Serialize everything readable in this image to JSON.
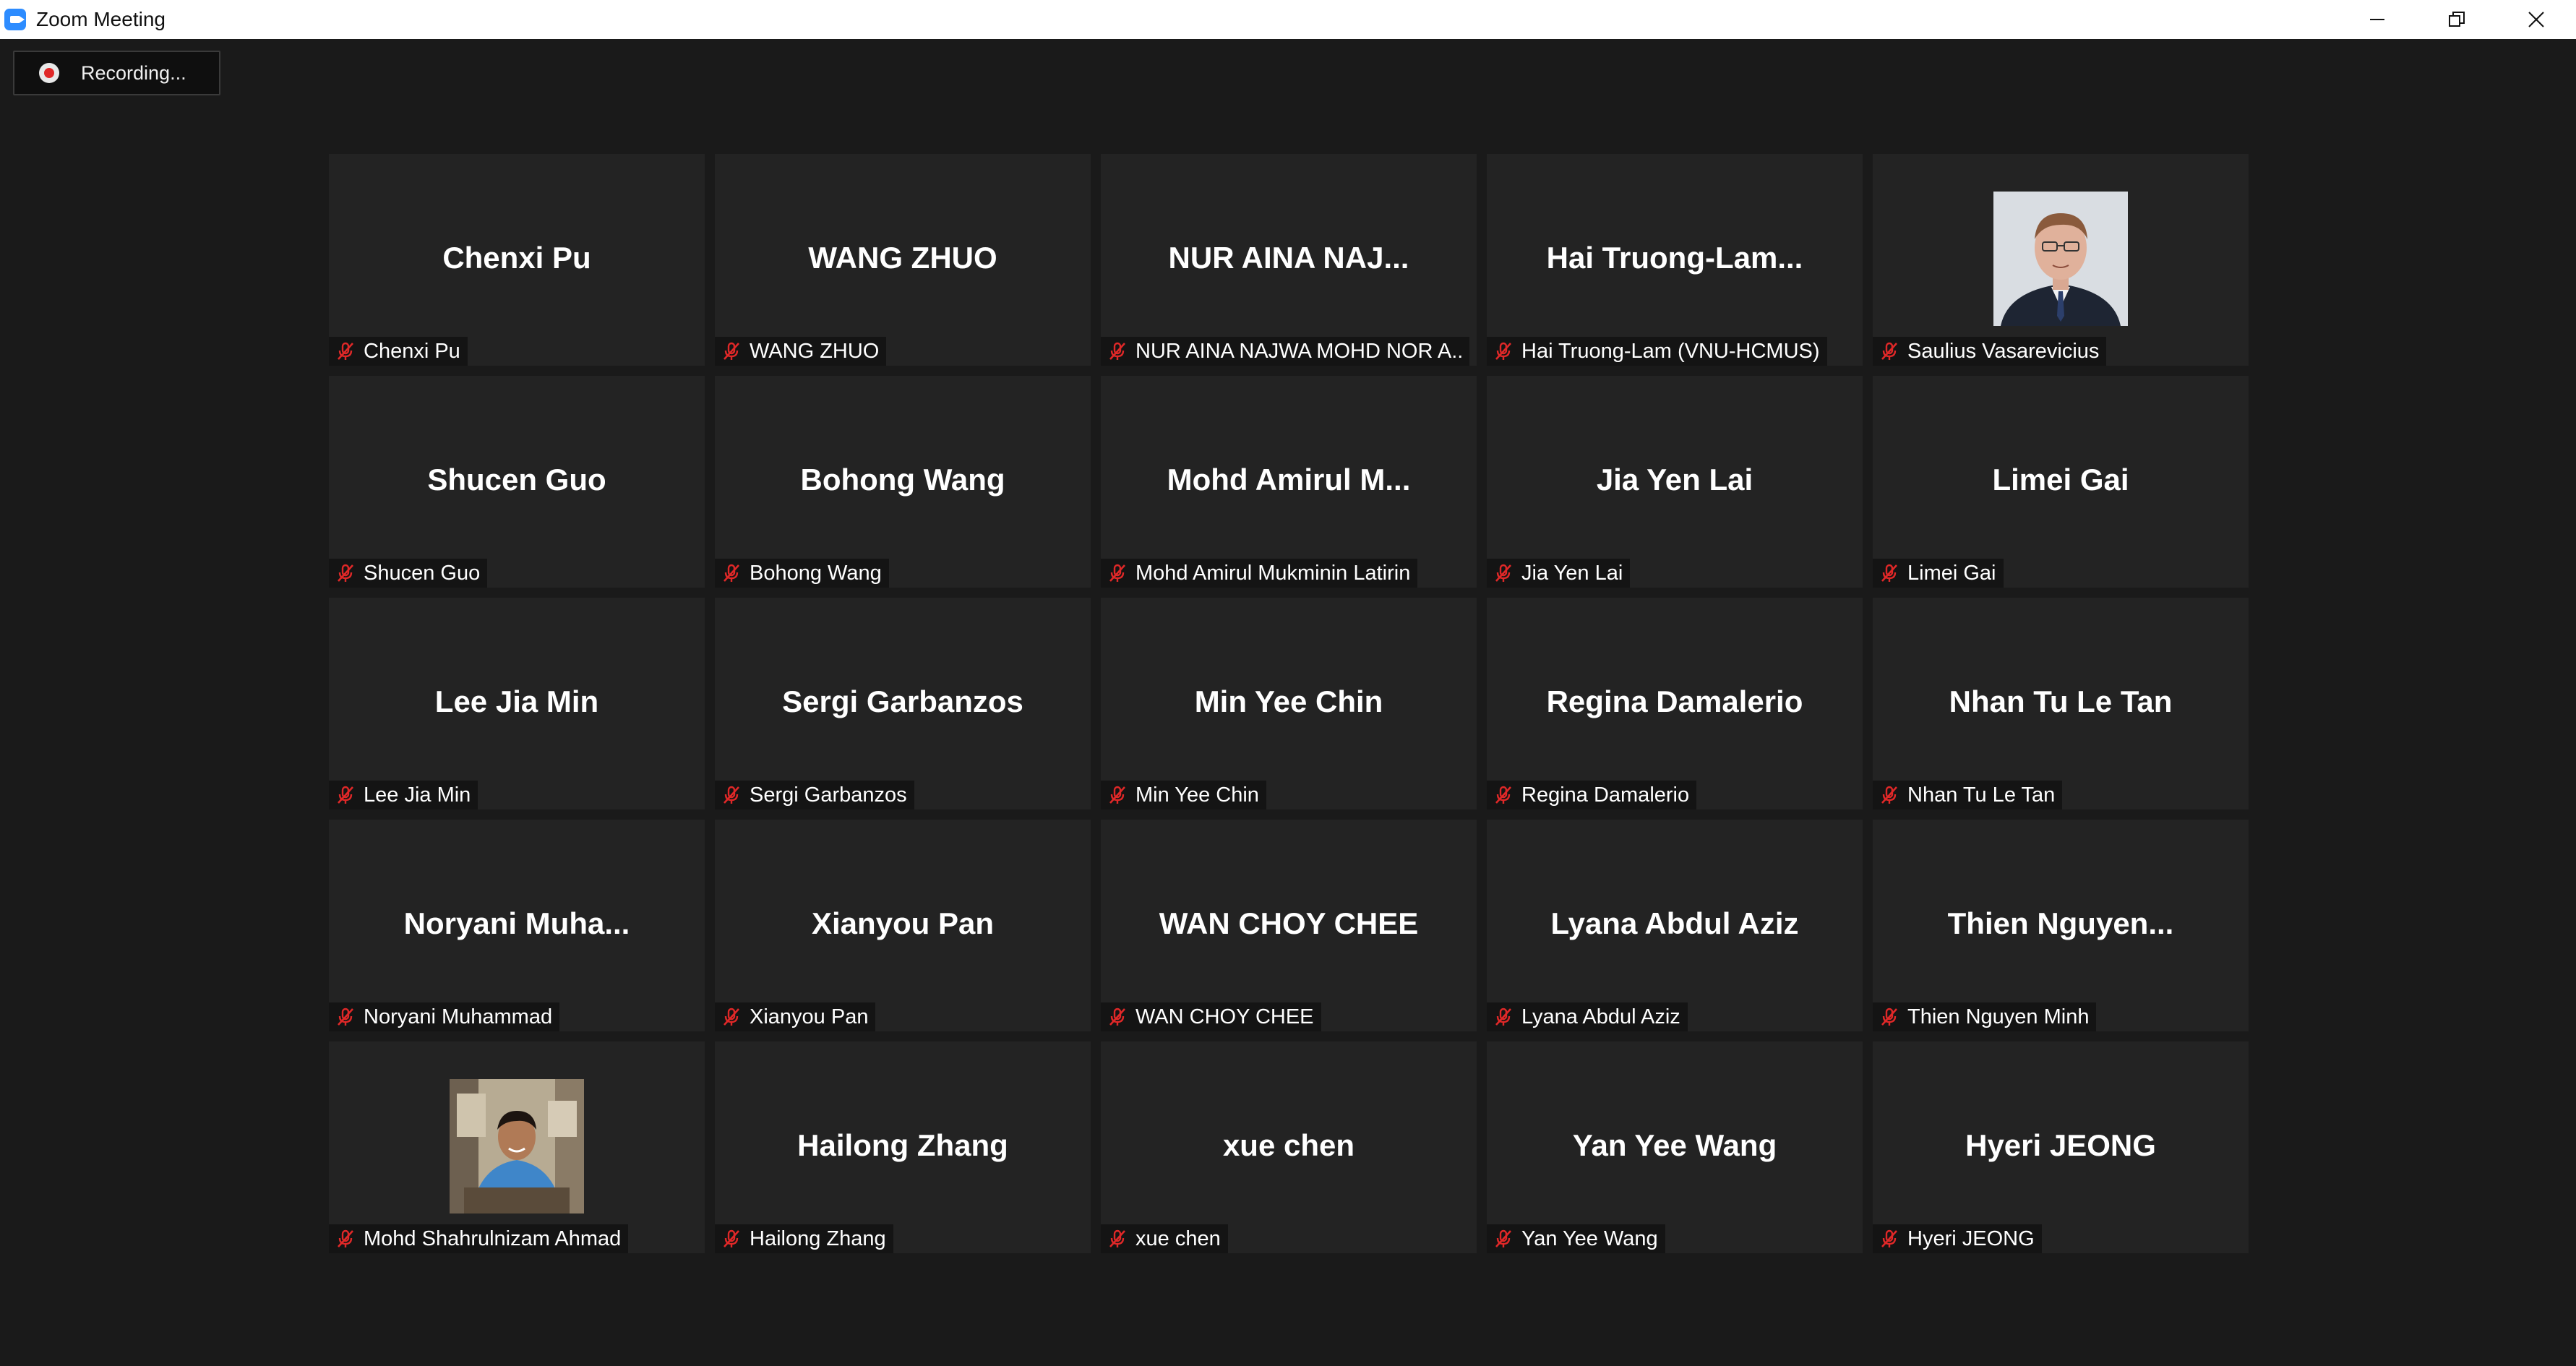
{
  "window": {
    "title": "Zoom Meeting",
    "icon": "zoom-camera-icon",
    "controls": [
      "minimize-icon",
      "restore-icon",
      "close-icon"
    ]
  },
  "recording": {
    "label": "Recording...",
    "icon": "record-dot-icon"
  },
  "colors": {
    "background": "#1a1a1a",
    "tile": "#232323",
    "mute": "#e02828",
    "titlebar": "#ffffff"
  },
  "participants": [
    {
      "display_name": "Chenxi Pu",
      "full_name": "Chenxi Pu",
      "muted": true
    },
    {
      "display_name": "WANG ZHUO",
      "full_name": "WANG ZHUO",
      "muted": true
    },
    {
      "display_name": "NUR AINA NAJ...",
      "full_name": "NUR AINA NAJWA MOHD NOR A...",
      "muted": true
    },
    {
      "display_name": "Hai Truong-Lam...",
      "full_name": "Hai Truong-Lam (VNU-HCMUS)",
      "muted": true
    },
    {
      "display_name": "",
      "full_name": "Saulius Vasarevicius",
      "muted": true,
      "photo": "profile-photo"
    },
    {
      "display_name": "Shucen Guo",
      "full_name": "Shucen Guo",
      "muted": true
    },
    {
      "display_name": "Bohong Wang",
      "full_name": "Bohong Wang",
      "muted": true
    },
    {
      "display_name": "Mohd Amirul M...",
      "full_name": "Mohd Amirul Mukminin Latirin",
      "muted": true
    },
    {
      "display_name": "Jia Yen Lai",
      "full_name": "Jia Yen Lai",
      "muted": true
    },
    {
      "display_name": "Limei Gai",
      "full_name": "Limei Gai",
      "muted": true
    },
    {
      "display_name": "Lee Jia Min",
      "full_name": "Lee Jia Min",
      "muted": true
    },
    {
      "display_name": "Sergi Garbanzos",
      "full_name": "Sergi Garbanzos",
      "muted": true
    },
    {
      "display_name": "Min Yee Chin",
      "full_name": "Min Yee Chin",
      "muted": true
    },
    {
      "display_name": "Regina Damalerio",
      "full_name": "Regina Damalerio",
      "muted": true
    },
    {
      "display_name": "Nhan Tu Le Tan",
      "full_name": "Nhan Tu Le Tan",
      "muted": true
    },
    {
      "display_name": "Noryani Muha...",
      "full_name": "Noryani Muhammad",
      "muted": true
    },
    {
      "display_name": "Xianyou Pan",
      "full_name": "Xianyou Pan",
      "muted": true
    },
    {
      "display_name": "WAN CHOY CHEE",
      "full_name": "WAN CHOY CHEE",
      "muted": true
    },
    {
      "display_name": "Lyana Abdul Aziz",
      "full_name": "Lyana Abdul Aziz",
      "muted": true
    },
    {
      "display_name": "Thien Nguyen...",
      "full_name": "Thien Nguyen Minh",
      "muted": true
    },
    {
      "display_name": "",
      "full_name": "Mohd Shahrulnizam Ahmad",
      "muted": true,
      "photo": "profile-photo"
    },
    {
      "display_name": "Hailong Zhang",
      "full_name": "Hailong Zhang",
      "muted": true
    },
    {
      "display_name": "xue chen",
      "full_name": "xue chen",
      "muted": true
    },
    {
      "display_name": "Yan Yee Wang",
      "full_name": "Yan Yee Wang",
      "muted": true
    },
    {
      "display_name": "Hyeri JEONG",
      "full_name": "Hyeri JEONG",
      "muted": true
    }
  ]
}
